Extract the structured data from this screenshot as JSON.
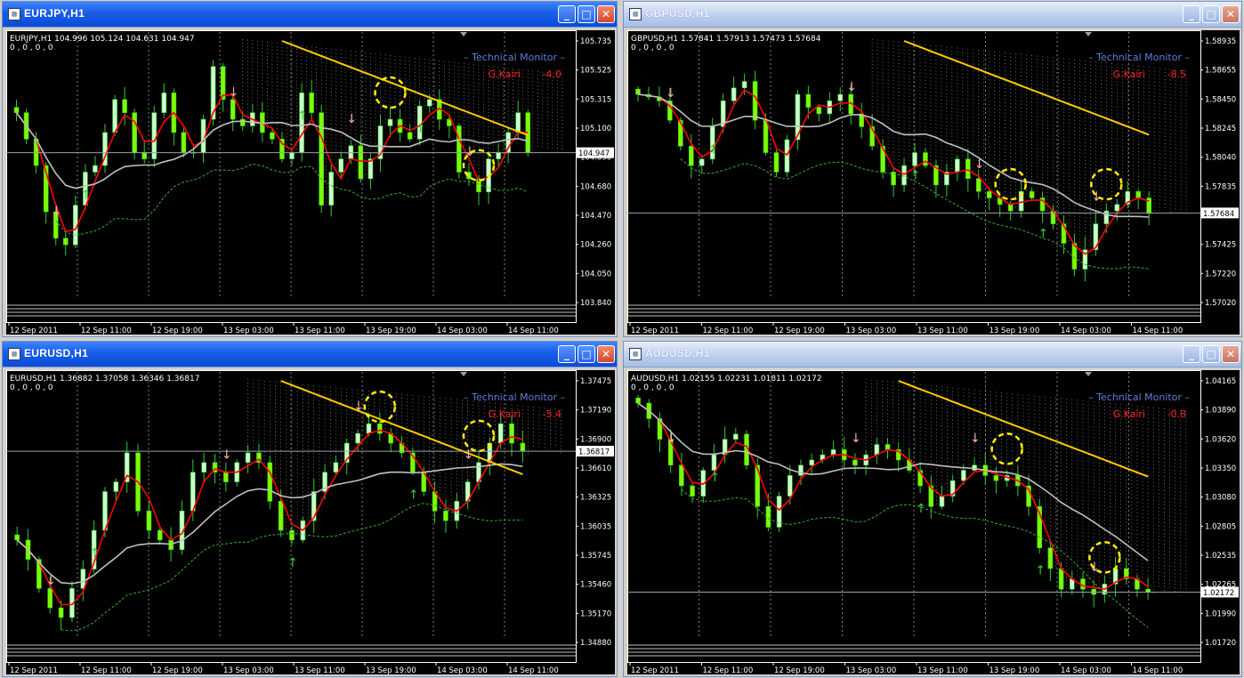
{
  "windows": [
    {
      "key": "w1",
      "title": "EURJPY,H1",
      "chart_data": {
        "type": "candlestick",
        "title": "EURJPY,H1",
        "header": "EURJPY,H1  104.996 105.124 104.631 104.947",
        "subheader": "0 , 0 , 0 , 0",
        "indicator_label": "Technical Monitor",
        "indicator_name": "G.Kairi",
        "indicator_value": "-4.0",
        "price_ticks": [
          "105.735",
          "105.525",
          "105.315",
          "105.100",
          "104.890",
          "104.680",
          "104.470",
          "104.260",
          "104.050",
          "103.840"
        ],
        "ylim": [
          103.84,
          105.82
        ],
        "current_price": "104.947",
        "current_value": 104.947,
        "x_ticks": [
          "12 Sep 2011",
          "12 Sep 11:00",
          "12 Sep 19:00",
          "13 Sep 03:00",
          "13 Sep 11:00",
          "13 Sep 19:00",
          "14 Sep 03:00",
          "14 Sep 11:00"
        ],
        "closes": [
          105.25,
          105.05,
          104.85,
          104.5,
          104.3,
          104.25,
          104.55,
          104.8,
          104.85,
          105.1,
          105.35,
          105.25,
          104.95,
          104.9,
          105.25,
          105.4,
          105.1,
          104.95,
          104.95,
          105.2,
          105.6,
          105.35,
          105.2,
          105.15,
          105.25,
          105.1,
          105.05,
          104.9,
          104.95,
          105.4,
          105.25,
          104.55,
          104.8,
          104.9,
          105.0,
          104.75,
          104.9,
          105.15,
          105.2,
          105.1,
          105.05,
          105.3,
          105.35,
          105.2,
          105.15,
          104.8,
          104.75,
          104.65,
          104.9,
          104.95,
          105.1,
          105.25,
          104.95
        ]
      }
    },
    {
      "key": "w2",
      "title": "GBPUSD,H1",
      "chart_data": {
        "type": "candlestick",
        "title": "GBPUSD,H1",
        "header": "GBPUSD,H1  1.57841 1.57913 1.57473 1.57684",
        "subheader": "0 , 0 , 0 , 0",
        "indicator_label": "Technical Monitor",
        "indicator_name": "G.Kairi",
        "indicator_value": "-8.5",
        "price_ticks": [
          "1.58935",
          "1.58655",
          "1.58450",
          "1.58245",
          "1.58040",
          "1.57835",
          "1.57630",
          "1.57425",
          "1.57220",
          "1.57020"
        ],
        "ylim": [
          1.5702,
          1.5904
        ],
        "current_price": "1.57684",
        "current_value": 1.57684,
        "x_ticks": [
          "12 Sep 2011",
          "12 Sep 11:00",
          "12 Sep 19:00",
          "13 Sep 03:00",
          "13 Sep 11:00",
          "13 Sep 19:00",
          "14 Sep 03:00",
          "14 Sep 11:00"
        ],
        "closes": [
          1.586,
          1.5858,
          1.5855,
          1.584,
          1.582,
          1.5805,
          1.581,
          1.5835,
          1.5855,
          1.5865,
          1.587,
          1.584,
          1.5815,
          1.58,
          1.5825,
          1.586,
          1.585,
          1.5845,
          1.5855,
          1.586,
          1.5845,
          1.5835,
          1.582,
          1.58,
          1.579,
          1.5805,
          1.5815,
          1.5805,
          1.579,
          1.58,
          1.581,
          1.5795,
          1.5785,
          1.578,
          1.5775,
          1.577,
          1.5785,
          1.578,
          1.577,
          1.576,
          1.5745,
          1.5725,
          1.574,
          1.576,
          1.577,
          1.5775,
          1.5785,
          1.578,
          1.5768
        ]
      }
    },
    {
      "key": "w3",
      "title": "EURUSD,H1",
      "chart_data": {
        "type": "candlestick",
        "title": "EURUSD,H1",
        "header": "EURUSD,H1  1.36882 1.37058 1.36346 1.36817",
        "subheader": "0 , 0 , 0 , 0",
        "indicator_label": "Technical Monitor",
        "indicator_name": "G.Kairi",
        "indicator_value": "-5.4",
        "price_ticks": [
          "1.37475",
          "1.37190",
          "1.36900",
          "1.36610",
          "1.36325",
          "1.36035",
          "1.35745",
          "1.35460",
          "1.35170",
          "1.34880"
        ],
        "ylim": [
          1.3488,
          1.3758
        ],
        "current_price": "1.36817",
        "current_value": 1.36817,
        "x_ticks": [
          "12 Sep 2011",
          "12 Sep 11:00",
          "12 Sep 19:00",
          "13 Sep 03:00",
          "13 Sep 11:00",
          "13 Sep 19:00",
          "14 Sep 03:00",
          "14 Sep 11:00"
        ],
        "closes": [
          1.359,
          1.357,
          1.354,
          1.352,
          1.351,
          1.354,
          1.356,
          1.36,
          1.364,
          1.365,
          1.368,
          1.362,
          1.36,
          1.359,
          1.358,
          1.362,
          1.366,
          1.367,
          1.366,
          1.365,
          1.367,
          1.368,
          1.367,
          1.363,
          1.36,
          1.359,
          1.361,
          1.364,
          1.366,
          1.367,
          1.369,
          1.37,
          1.371,
          1.37,
          1.369,
          1.368,
          1.366,
          1.364,
          1.362,
          1.361,
          1.363,
          1.365,
          1.367,
          1.369,
          1.371,
          1.369,
          1.3682
        ]
      }
    },
    {
      "key": "w4",
      "title": "AUDUSD,H1",
      "chart_data": {
        "type": "candlestick",
        "title": "AUDUSD,H1",
        "header": "AUDUSD,H1  1.02155 1.02231 1.01811 1.02172",
        "subheader": "0 , 0 , 0 , 0",
        "indicator_label": "Technical Monitor",
        "indicator_name": "G.Kairi",
        "indicator_value": "-0.8",
        "price_ticks": [
          "1.04165",
          "1.03890",
          "1.03620",
          "1.03350",
          "1.03080",
          "1.02805",
          "1.02535",
          "1.02265",
          "1.01990",
          "1.01720"
        ],
        "ylim": [
          1.0172,
          1.0425
        ],
        "current_price": "1.02172",
        "current_value": 1.02172,
        "x_ticks": [
          "12 Sep 2011",
          "12 Sep 11:00",
          "12 Sep 19:00",
          "13 Sep 03:00",
          "13 Sep 11:00",
          "13 Sep 19:00",
          "14 Sep 03:00",
          "14 Sep 11:00"
        ],
        "closes": [
          1.04,
          1.0385,
          1.0365,
          1.034,
          1.032,
          1.031,
          1.0335,
          1.035,
          1.0365,
          1.037,
          1.034,
          1.03,
          1.028,
          1.031,
          1.033,
          1.034,
          1.0345,
          1.035,
          1.0355,
          1.0345,
          1.034,
          1.035,
          1.036,
          1.0355,
          1.0345,
          1.0335,
          1.032,
          1.03,
          1.031,
          1.0325,
          1.0335,
          1.034,
          1.033,
          1.0325,
          1.033,
          1.032,
          1.03,
          1.026,
          1.024,
          1.022,
          1.023,
          1.022,
          1.0215,
          1.0225,
          1.024,
          1.023,
          1.022,
          1.0217
        ]
      }
    }
  ],
  "colors": {
    "background": "#000000",
    "bull_candle": "#ccffcc",
    "bear_candle": "#7cfc00",
    "wick": "#33cc33",
    "ma_fast": "#ff0000",
    "ma_slow": "#c0c0c0",
    "ma_long": "#ffcc00",
    "cloud": "#ffffff",
    "band": "#33aa33",
    "grid": "#808080",
    "axis_text": "#ffffff",
    "indicator_label": "#5c7fd6",
    "indicator_value": "#ff2222",
    "highlight_circle": "#ffee00"
  },
  "icons": [
    "chart-window-icon",
    "minimize-icon",
    "maximize-icon",
    "close-icon"
  ]
}
